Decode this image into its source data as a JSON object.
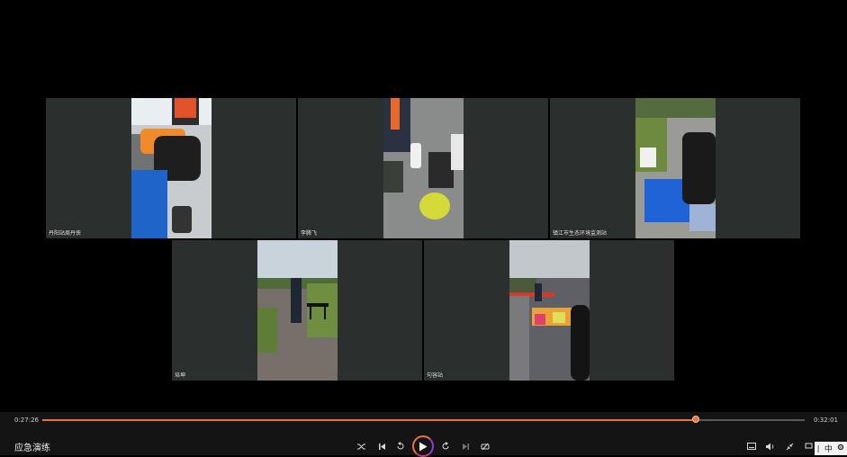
{
  "tiles": [
    {
      "label": "丹阳站周丹侠"
    },
    {
      "label": "李腾飞"
    },
    {
      "label": "镇江市生态环境监测站"
    },
    {
      "label": "培坤"
    },
    {
      "label": "句容站"
    }
  ],
  "player": {
    "title": "应急演练",
    "current_time": "0:27:26",
    "total_time": "0:32:01",
    "progress": 0.857
  },
  "ime": {
    "mode_label": "中"
  },
  "icons": [
    "shuffle-icon",
    "previous-icon",
    "rewind-icon",
    "play-icon",
    "forward-icon",
    "next-icon",
    "loop-icon",
    "subtitle-icon",
    "volume-icon",
    "fullscreen-exit-icon",
    "pin-icon",
    "gear-icon"
  ]
}
